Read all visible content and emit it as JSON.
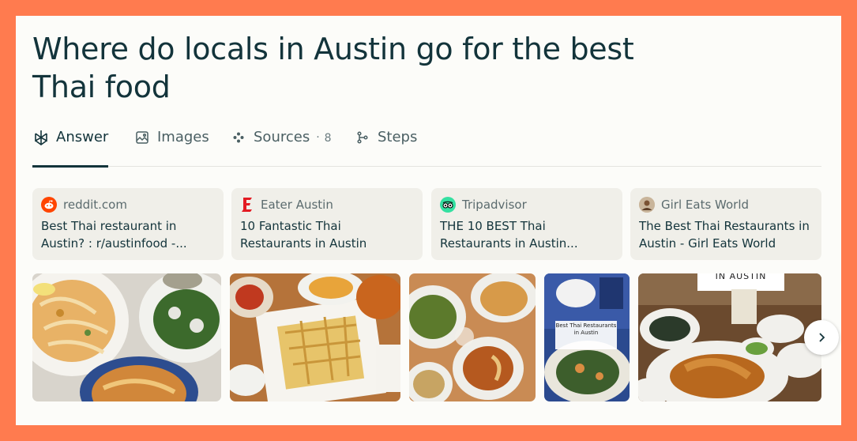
{
  "query": {
    "title": "Where do locals in Austin go for the best Thai food"
  },
  "tabs": [
    {
      "label": "Answer",
      "icon": "perplexity-logo-icon",
      "active": true
    },
    {
      "label": "Images",
      "icon": "image-icon"
    },
    {
      "label": "Sources",
      "icon": "sources-icon",
      "separator": "·",
      "count": "8"
    },
    {
      "label": "Steps",
      "icon": "steps-icon"
    }
  ],
  "sources": [
    {
      "site": "reddit.com",
      "title": "Best Thai restaurant in Austin? : r/austinfood -...",
      "icon": "reddit-icon",
      "color": "#ff4500"
    },
    {
      "site": "Eater Austin",
      "title": "10 Fantastic Thai Restaurants in Austin",
      "icon": "eater-icon",
      "color": "#e31b23"
    },
    {
      "site": "Tripadvisor",
      "title": "THE 10 BEST Thai Restaurants in Austin...",
      "icon": "tripadvisor-icon",
      "color": "#34e0a1"
    },
    {
      "site": "Girl Eats World",
      "title": "The Best Thai Restaurants in Austin - Girl Eats World",
      "icon": "avatar-icon",
      "color": "#b08a6a"
    }
  ],
  "images": {
    "overlay_best_thai": "Best Thai Restaurants in Austin",
    "overlay_in_austin": "IN AUSTIN"
  },
  "colors": {
    "background": "#ff7b4f",
    "panel": "#fcfcf9",
    "text": "#13343b",
    "card": "#f0efe9"
  }
}
